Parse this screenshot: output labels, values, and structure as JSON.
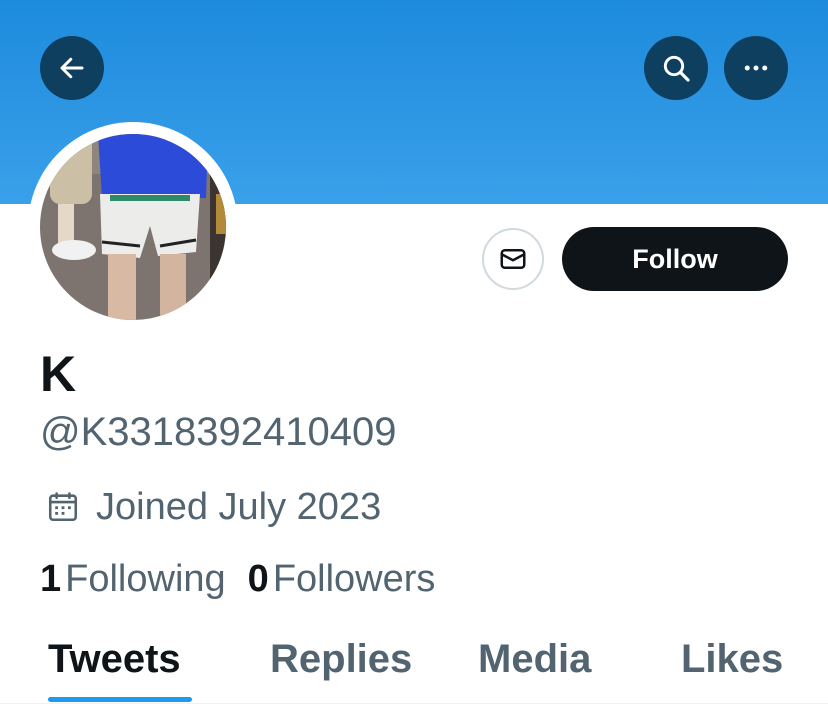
{
  "header": {
    "back_icon": "arrow-left-icon",
    "search_icon": "search-icon",
    "more_icon": "more-horizontal-icon",
    "banner_color": "#1d8bdc"
  },
  "profile": {
    "display_name": "K",
    "handle": "@K3318392410409",
    "joined": "Joined July 2023",
    "joined_icon": "calendar-icon",
    "following_count": "1",
    "following_label": "Following",
    "followers_count": "0",
    "followers_label": "Followers"
  },
  "actions": {
    "message_icon": "envelope-icon",
    "follow_label": "Follow"
  },
  "tabs": [
    {
      "label": "Tweets",
      "active": true
    },
    {
      "label": "Replies",
      "active": false
    },
    {
      "label": "Media",
      "active": false
    },
    {
      "label": "Likes",
      "active": false
    }
  ],
  "colors": {
    "accent": "#1d9bf0",
    "text_primary": "#0f1419",
    "text_secondary": "#536471"
  }
}
